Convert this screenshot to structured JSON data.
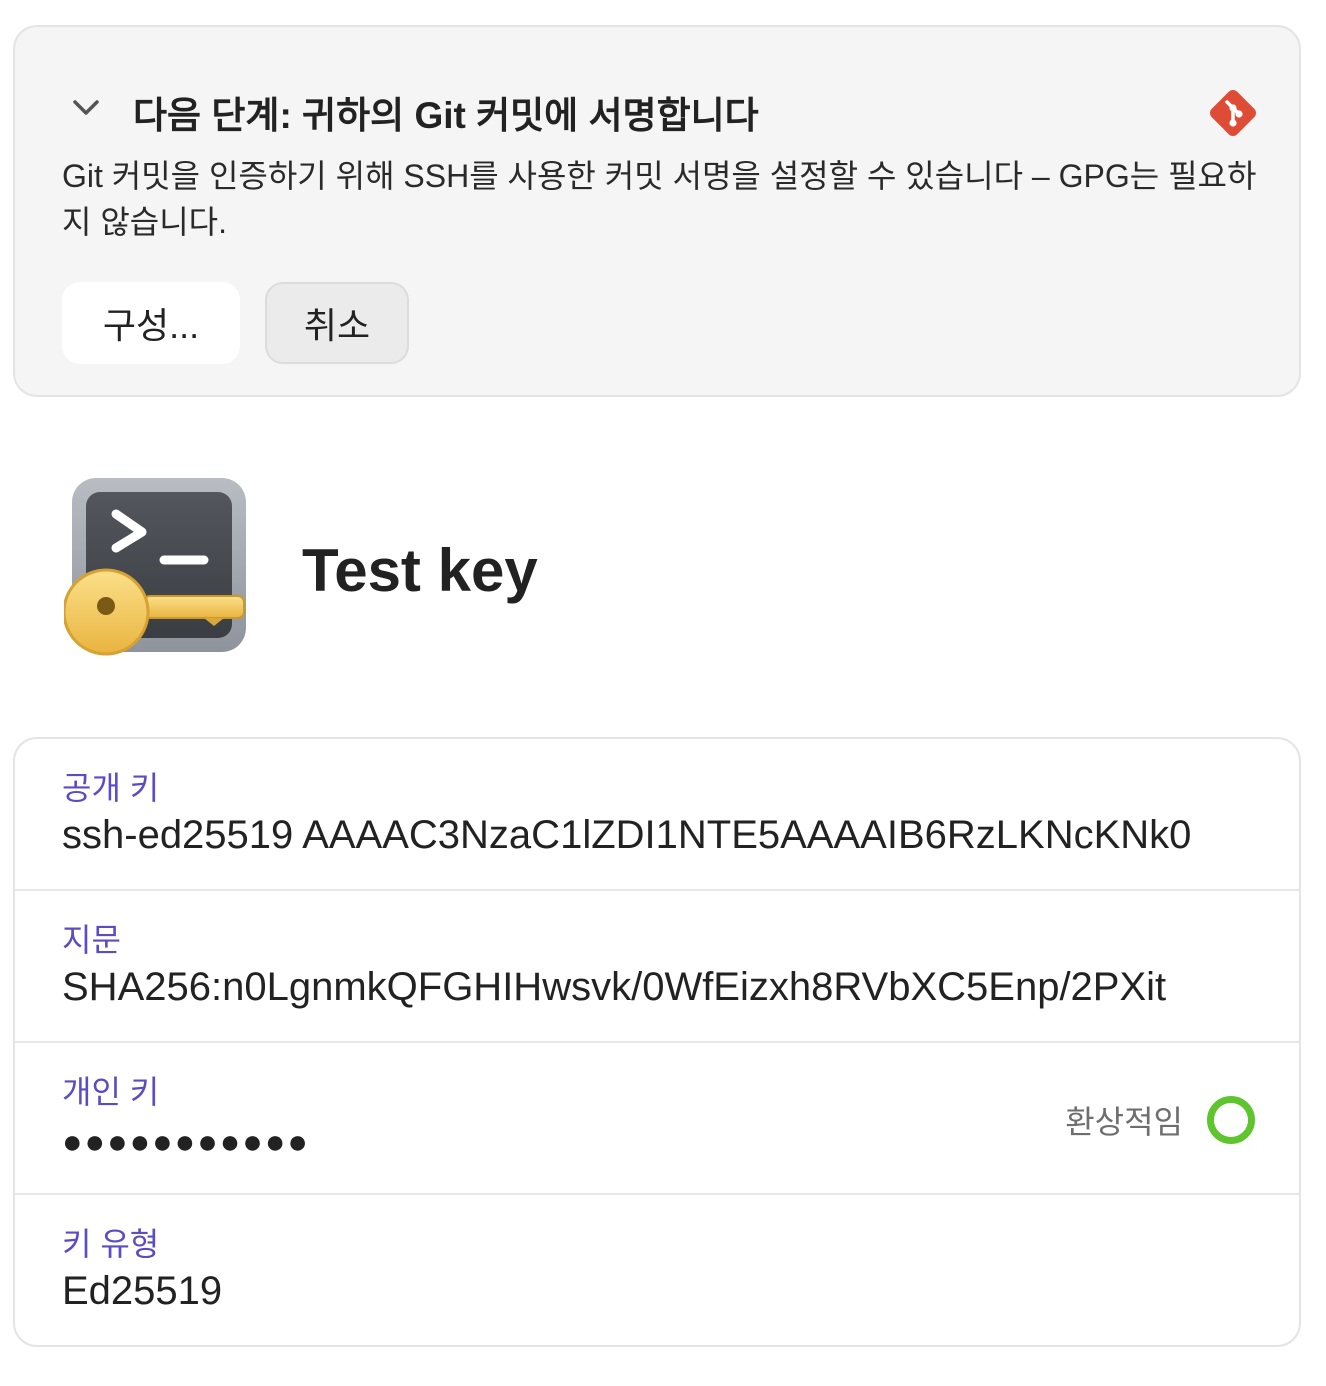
{
  "banner": {
    "title": "다음 단계: 귀하의 Git 커밋에 서명합니다",
    "description": "Git 커밋을 인증하기 위해 SSH를 사용한 커밋 서명을 설정할 수 있습니다 – GPG는 필요하지 않습니다.",
    "configure_label": "구성...",
    "cancel_label": "취소",
    "icons": {
      "collapse": "chevron-down-icon",
      "brand": "git-icon"
    },
    "colors": {
      "git": "#de4c36"
    }
  },
  "key": {
    "title": "Test key",
    "icon": "ssh-key-app-icon"
  },
  "fields": {
    "public_key": {
      "label": "공개 키",
      "value": "ssh-ed25519 AAAAC3NzaC1lZDI1NTE5AAAAIB6RzLKNcKNk0"
    },
    "fingerprint": {
      "label": "지문",
      "value": "SHA256:n0LgnmkQFGHIHwsvk/0WfEizxh8RVbXC5Enp/2PXit"
    },
    "private_key": {
      "label": "개인 키",
      "value": "●●●●●●●●●●●",
      "strength_label": "환상적임",
      "strength_color": "#5fc52e"
    },
    "key_type": {
      "label": "키 유형",
      "value": "Ed25519"
    }
  },
  "colors": {
    "label": "#5b4cc4"
  }
}
